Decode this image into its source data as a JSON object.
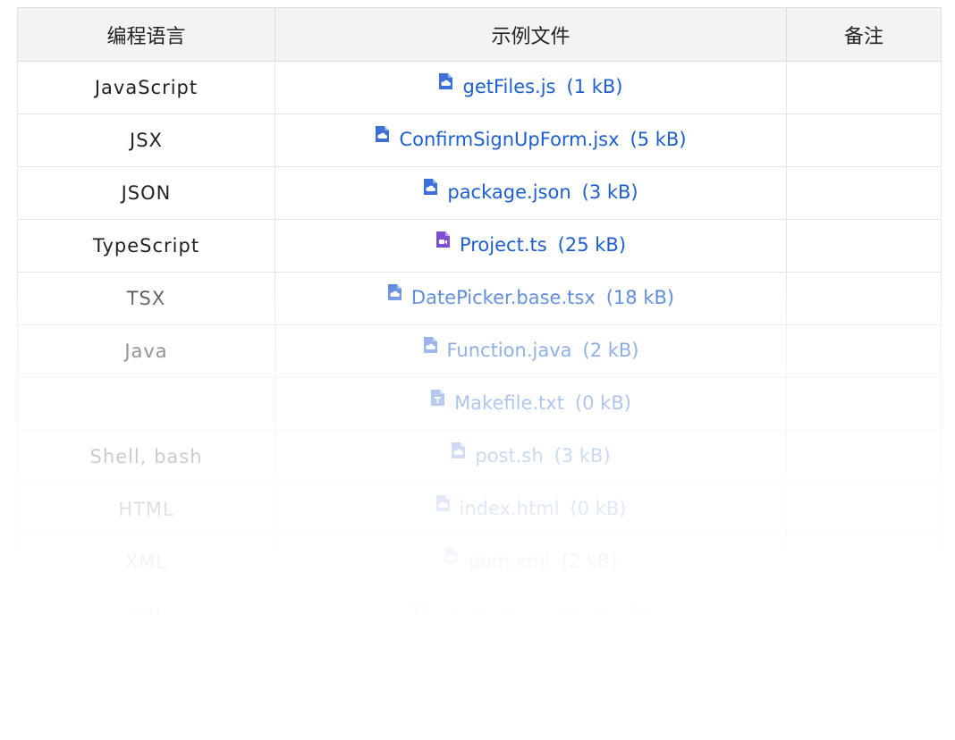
{
  "table": {
    "headers": [
      "编程语言",
      "示例文件",
      "备注"
    ],
    "rows": [
      {
        "language": "JavaScript",
        "file": "getFiles.js",
        "size": "(1 kB)",
        "icon": "document-icon",
        "icon_color": "#3d6fd8",
        "note": ""
      },
      {
        "language": "JSX",
        "file": "ConfirmSignUpForm.jsx",
        "size": "(5 kB)",
        "icon": "document-icon",
        "icon_color": "#3d6fd8",
        "note": ""
      },
      {
        "language": "JSON",
        "file": "package.json",
        "size": "(3 kB)",
        "icon": "document-icon",
        "icon_color": "#3d6fd8",
        "note": ""
      },
      {
        "language": "TypeScript",
        "file": "Project.ts",
        "size": "(25 kB)",
        "icon": "video-file-icon",
        "icon_color": "#7e4fd0",
        "note": ""
      },
      {
        "language": "TSX",
        "file": "DatePicker.base.tsx",
        "size": "(18 kB)",
        "icon": "document-icon",
        "icon_color": "#3d6fd8",
        "note": ""
      },
      {
        "language": "Java",
        "file": "Function.java",
        "size": "(2 kB)",
        "icon": "document-icon",
        "icon_color": "#3d6fd8",
        "note": ""
      },
      {
        "language": "",
        "file": "Makefile.txt",
        "size": "(0 kB)",
        "icon": "text-file-icon",
        "icon_color": "#3d6fd8",
        "note": ""
      },
      {
        "language": "Shell, bash",
        "file": "post.sh",
        "size": "(3 kB)",
        "icon": "document-icon",
        "icon_color": "#3d6fd8",
        "note": ""
      },
      {
        "language": "HTML",
        "file": "index.html",
        "size": "(0 kB)",
        "icon": "document-icon",
        "icon_color": "#3d6fd8",
        "note": ""
      },
      {
        "language": "XML",
        "file": "pom.xml",
        "size": "(2 kB)",
        "icon": "document-icon",
        "icon_color": "#3d6fd8",
        "note": ""
      },
      {
        "language": "YML",
        "file": "application.yml",
        "size": "(1 kB)",
        "icon": "document-icon",
        "icon_color": "#3d6fd8",
        "note": ""
      }
    ]
  },
  "colors": {
    "link": "#1d5fcf",
    "header_bg": "#f3f3f3",
    "border": "#e4e4e4"
  }
}
